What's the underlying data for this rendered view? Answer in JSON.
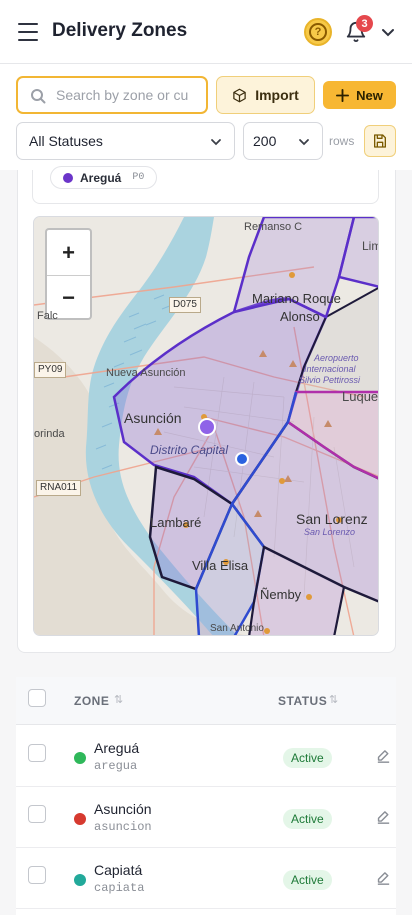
{
  "header": {
    "title": "Delivery Zones",
    "help_icon": "question-icon",
    "notification_count": "3"
  },
  "toolbar": {
    "search_placeholder": "Search by zone or cu",
    "search_value": "",
    "import_label": "Import",
    "new_label": "New",
    "status_filter": "All Statuses",
    "rows_value": "200",
    "rows_label": "rows"
  },
  "legend": {
    "name": "Areguá",
    "code": "P0",
    "color": "#6b35c9"
  },
  "map": {
    "zoom_in": "+",
    "zoom_out": "−",
    "labels": {
      "remanso": "Remanso C",
      "lim": "Lim",
      "mariano1": "Mariano Roque",
      "mariano2": "Alonso",
      "falcon": "Falc",
      "aero1": "Aeropuerto",
      "aero2": "Internacional",
      "aero3": "Silvio Pettirossi",
      "nueva": "Nueva Asunción",
      "luque": "Luque",
      "asuncion": "Asunción",
      "distrito": "Distrito Capital",
      "corinda": "orinda",
      "lambare": "Lambaré",
      "sanlorenzo": "San Lorenz",
      "sanlorenzo2": "San Lorenzo",
      "villaelisa": "Villa Elisa",
      "nemby": "Ñemby",
      "sanantonio": "San Antonio"
    },
    "shields": {
      "d075": "D075",
      "py09": "PY09",
      "rna011": "RNA011"
    }
  },
  "table": {
    "columns": {
      "zone": "ZONE",
      "status": "STATUS"
    },
    "rows": [
      {
        "name": "Areguá",
        "slug": "aregua",
        "status": "Active",
        "color": "#2fb85a"
      },
      {
        "name": "Asunción",
        "slug": "asuncion",
        "status": "Active",
        "color": "#d63a2f"
      },
      {
        "name": "Capiatá",
        "slug": "capiata",
        "status": "Active",
        "color": "#22a99a"
      }
    ]
  },
  "colors": {
    "accent": "#f7b733",
    "active_bg": "#e4f6e8",
    "active_fg": "#1e7a38"
  }
}
